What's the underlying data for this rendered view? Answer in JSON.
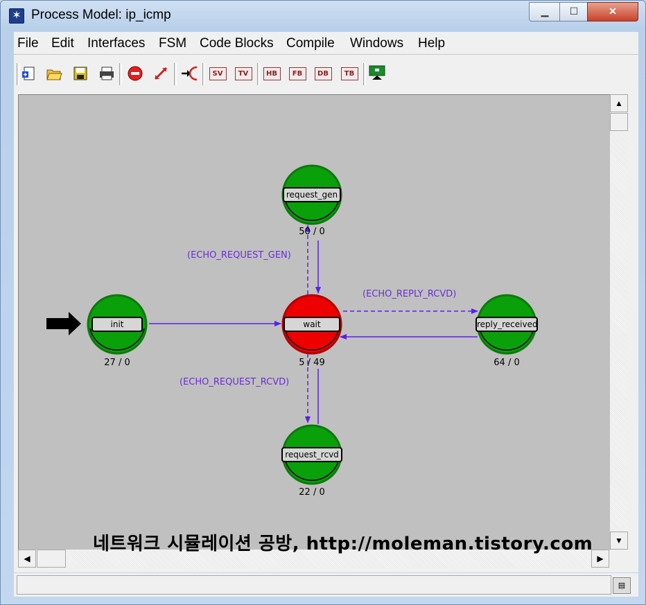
{
  "window": {
    "title": "Process Model: ip_icmp"
  },
  "menu": [
    "File",
    "Edit",
    "Interfaces",
    "FSM",
    "Code Blocks",
    "Compile",
    "Windows",
    "Help"
  ],
  "toolbar": {
    "text_buttons": [
      "SV",
      "TV",
      "HB",
      "FB",
      "DB",
      "TB"
    ]
  },
  "states": [
    {
      "name": "request_gen",
      "counts": "50 / 0",
      "color": "#0aa00a"
    },
    {
      "name": "init",
      "counts": "27 / 0",
      "color": "#0aa00a"
    },
    {
      "name": "wait",
      "counts": "5 / 49",
      "color": "#ee0000"
    },
    {
      "name": "reply_received",
      "counts": "64 / 0",
      "color": "#0aa00a"
    },
    {
      "name": "request_rcvd",
      "counts": "22 / 0",
      "color": "#0aa00a"
    }
  ],
  "transitions": [
    {
      "label": "(ECHO_REQUEST_GEN)"
    },
    {
      "label": "(ECHO_REPLY_RCVD)"
    },
    {
      "label": "(ECHO_REQUEST_RCVD)"
    }
  ],
  "watermark": "네트워크 시뮬레이션 공방, http://moleman.tistory.com",
  "colors": {
    "transition": "#5a1ef0",
    "canvas": "#c0c0c0"
  }
}
